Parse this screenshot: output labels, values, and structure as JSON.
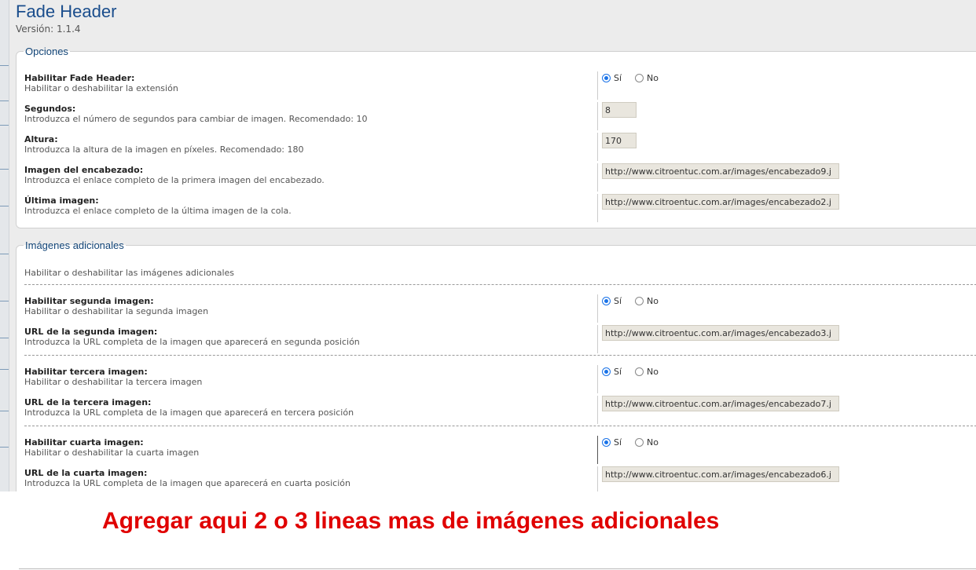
{
  "header": {
    "title": "Fade Header",
    "version": "Versión: 1.1.4"
  },
  "options": {
    "legend": "Opciones",
    "enable": {
      "label": "Habilitar Fade Header:",
      "explain": "Habilitar o deshabilitar la extensión",
      "yes": "Sí",
      "no": "No",
      "selected": "yes"
    },
    "seconds": {
      "label": "Segundos:",
      "explain": "Introduzca el número de segundos para cambiar de imagen. Recomendado: 10",
      "value": "8"
    },
    "height": {
      "label": "Altura:",
      "explain": "Introduzca la altura de la imagen en píxeles. Recomendado: 180",
      "value": "170"
    },
    "header_image": {
      "label": "Imagen del encabezado:",
      "explain": "Introduzca el enlace completo de la primera imagen del encabezado.",
      "value": "http://www.citroentuc.com.ar/images/encabezado9.j"
    },
    "last_image": {
      "label": "Última imagen:",
      "explain": "Introduzca el enlace completo de la última imagen de la cola.",
      "value": "http://www.citroentuc.com.ar/images/encabezado2.j"
    }
  },
  "extra": {
    "legend": "Imágenes adicionales",
    "intro": "Habilitar o deshabilitar las imágenes adicionales",
    "second_enable": {
      "label": "Habilitar segunda imagen:",
      "explain": "Habilitar o deshabilitar la segunda imagen",
      "yes": "Sí",
      "no": "No",
      "selected": "yes"
    },
    "second_url": {
      "label": "URL de la segunda imagen:",
      "explain": "Introduzca la URL completa de la imagen que aparecerá en segunda posición",
      "value": "http://www.citroentuc.com.ar/images/encabezado3.j"
    },
    "third_enable": {
      "label": "Habilitar tercera imagen:",
      "explain": "Habilitar o deshabilitar la tercera imagen",
      "yes": "Sí",
      "no": "No",
      "selected": "yes"
    },
    "third_url": {
      "label": "URL de la tercera imagen:",
      "explain": "Introduzca la URL completa de la imagen que aparecerá en tercera posición",
      "value": "http://www.citroentuc.com.ar/images/encabezado7.j"
    },
    "fourth_enable": {
      "label": "Habilitar cuarta imagen:",
      "explain": "Habilitar o deshabilitar la cuarta imagen",
      "yes": "Sí",
      "no": "No",
      "selected": "yes"
    },
    "fourth_url": {
      "label": "URL de la cuarta imagen:",
      "explain": "Introduzca la URL completa de la imagen que aparecerá en cuarta posición",
      "value": "http://www.citroentuc.com.ar/images/encabezado6.j"
    }
  },
  "annotation": {
    "text": "Agregar aqui 2 o 3 lineas mas de imágenes adicionales",
    "color": "#e00000"
  }
}
